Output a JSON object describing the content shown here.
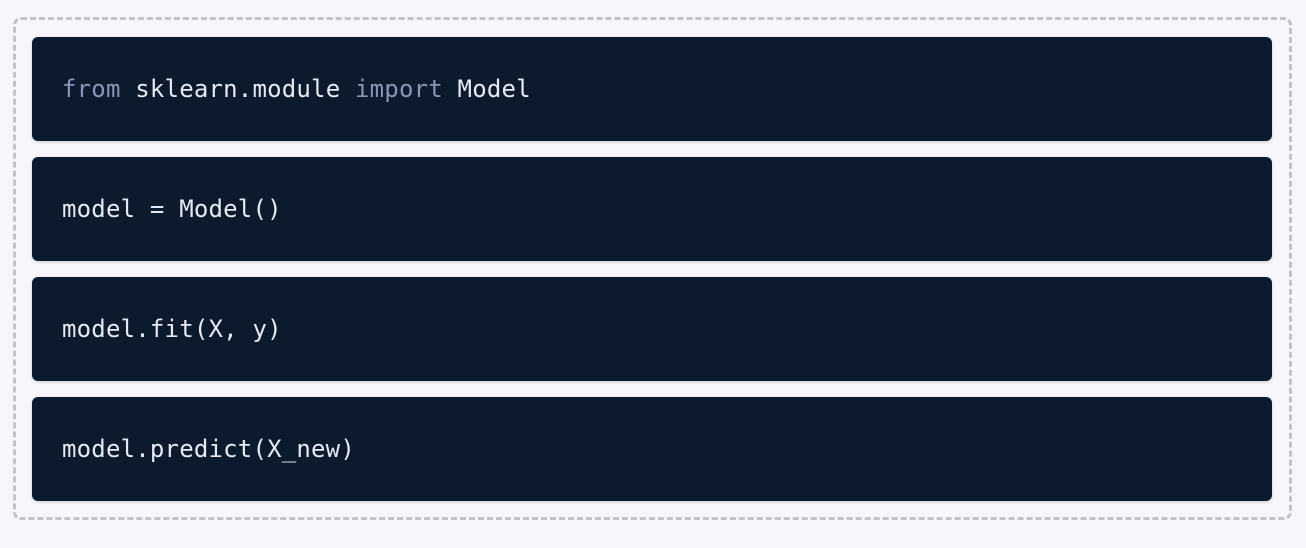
{
  "code_cells": [
    {
      "tokens": [
        {
          "text": "from",
          "kind": "keyword"
        },
        {
          "text": " sklearn.module ",
          "kind": "text"
        },
        {
          "text": "import",
          "kind": "keyword"
        },
        {
          "text": " Model",
          "kind": "text"
        }
      ]
    },
    {
      "tokens": [
        {
          "text": "model = Model()",
          "kind": "text"
        }
      ]
    },
    {
      "tokens": [
        {
          "text": "model.fit(X, y)",
          "kind": "text"
        }
      ]
    },
    {
      "tokens": [
        {
          "text": "model.predict(X_new)",
          "kind": "text"
        }
      ]
    }
  ],
  "colors": {
    "page_background": "#f7f6fd",
    "cell_background": "#0b1a2d",
    "keyword": "#8696b4",
    "code_text": "#e6e9f0",
    "dashed_border": "#c4c3c8"
  }
}
